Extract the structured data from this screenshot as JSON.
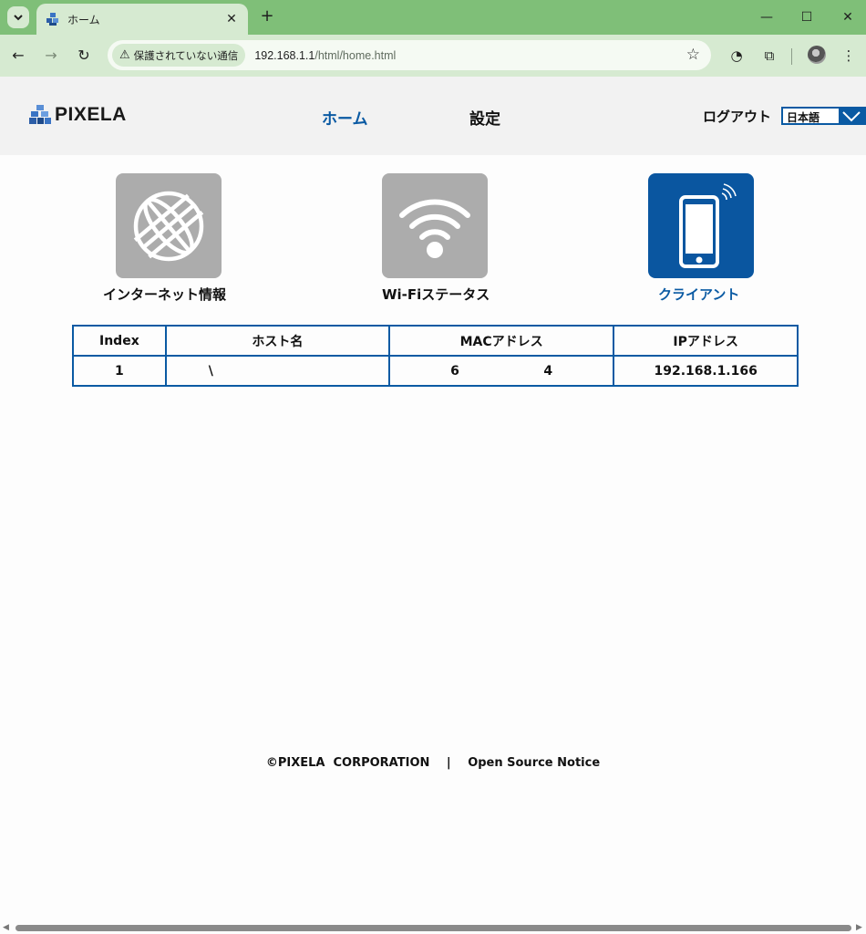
{
  "browser": {
    "tab_title": "ホーム",
    "new_tab": "+",
    "tab_close": "✕",
    "security_label": "保護されていない通信",
    "url_host": "192.168.1.1",
    "url_path": "/html/home.html",
    "window_controls": {
      "minimize": "—",
      "maximize": "☐",
      "close": "✕"
    }
  },
  "header": {
    "logo_text": "PIXELA",
    "nav": {
      "home": "ホーム",
      "settings": "設定"
    },
    "logout": "ログアウト",
    "language": "日本語"
  },
  "tiles": [
    {
      "label": "インターネット情報",
      "icon": "globe-icon",
      "active": false
    },
    {
      "label": "Wi-Fiステータス",
      "icon": "wifi-icon",
      "active": false
    },
    {
      "label": "クライアント",
      "icon": "smartphone-icon",
      "active": true
    }
  ],
  "client_table": {
    "headers": {
      "index": "Index",
      "host": "ホスト名",
      "mac": "MACアドレス",
      "ip": "IPアドレス"
    },
    "rows": [
      {
        "index": "1",
        "host": "\\",
        "mac": "6                   4",
        "ip": "192.168.1.166"
      }
    ]
  },
  "footer": {
    "copyright": "©PIXELA  CORPORATION",
    "separator": "|",
    "oss_link": "Open Source Notice"
  },
  "colors": {
    "accent": "#0a5aa3",
    "chrome": "#7fbf78",
    "tile_inactive": "#acacac"
  }
}
